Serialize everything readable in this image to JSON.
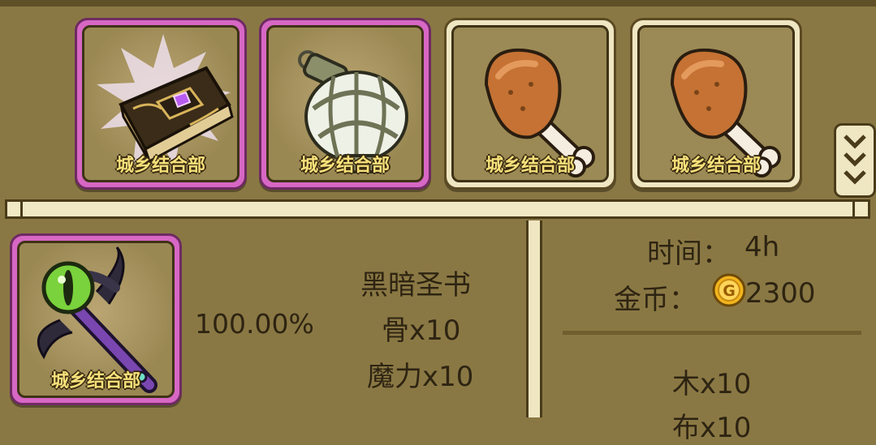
{
  "inventory": {
    "slots": [
      {
        "item": "dark-book",
        "rarity": "purple",
        "watermark": "城乡结合部"
      },
      {
        "item": "lantern",
        "rarity": "purple",
        "watermark": "城乡结合部"
      },
      {
        "item": "drumstick",
        "rarity": "gold",
        "watermark": "城乡结合部"
      },
      {
        "item": "drumstick",
        "rarity": "gold",
        "watermark": "城乡结合部"
      }
    ],
    "scroll_icon": "double-chevron-down-icon"
  },
  "recipe": {
    "result_item": "eye-staff",
    "result_watermark": "城乡结合部",
    "success_rate": "100.00%",
    "ingredient_title": "黑暗圣书",
    "ingredients": [
      "骨x10",
      "魔力x10"
    ]
  },
  "cost": {
    "time_label": "时间：",
    "time_value": "4h",
    "gold_label": "金币：",
    "gold_icon": "gold-coin-icon",
    "gold_value": "2300",
    "materials": [
      "木x10",
      "布x10"
    ]
  },
  "colors": {
    "background": "#8a7844",
    "purple_frame": "#d767c4",
    "gold_frame": "#efe6c2",
    "watermark": "#f6e07a"
  }
}
